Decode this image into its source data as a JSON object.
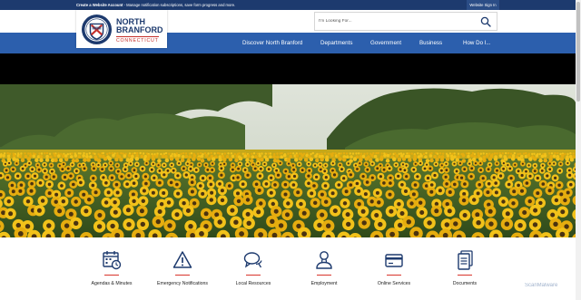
{
  "topbar": {
    "account_link": "Create a Website Account",
    "message": " - Manage notification subscriptions, save form progress and more.",
    "signin_label": "Website Sign In"
  },
  "logo": {
    "line1": "NORTH",
    "line2": "BRANFORD",
    "line3": "CONNECTICUT",
    "icon": "town-seal"
  },
  "search": {
    "placeholder": "I'm Looking For...",
    "icon": "search-icon"
  },
  "nav": {
    "items": [
      {
        "label": "Discover North Branford"
      },
      {
        "label": "Departments"
      },
      {
        "label": "Government"
      },
      {
        "label": "Business"
      },
      {
        "label": "How Do I..."
      }
    ]
  },
  "quick_links": [
    {
      "label": "Agendas & Minutes",
      "icon": "calendar-clock-icon"
    },
    {
      "label": "Emergency Notifications",
      "icon": "warning-icon"
    },
    {
      "label": "Local Resources",
      "icon": "chat-bubbles-icon"
    },
    {
      "label": "Employment",
      "icon": "person-icon"
    },
    {
      "label": "Online Services",
      "icon": "credit-card-icon"
    },
    {
      "label": "Documents",
      "icon": "documents-icon"
    }
  ],
  "watermark": "ScanMalware",
  "colors": {
    "topbar": "#1d3a6e",
    "nav": "#2c5fad",
    "accent_red": "#d9342b",
    "icon_navy": "#1d3a6e"
  }
}
